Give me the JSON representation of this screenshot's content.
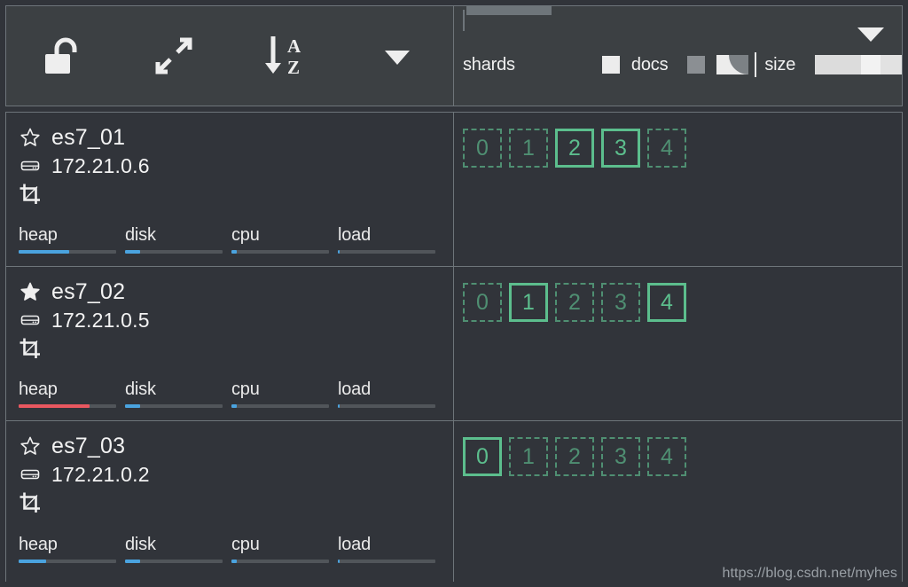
{
  "toolbar": {
    "buttons": [
      {
        "name": "unlock-icon",
        "label": "unlock"
      },
      {
        "name": "expand-arrows-icon",
        "label": "expand"
      },
      {
        "name": "sort-az-icon",
        "label": "sort A-Z"
      },
      {
        "name": "chevron-down-icon",
        "label": "more"
      }
    ]
  },
  "legend": {
    "shards_label": "shards",
    "docs_label": "docs",
    "size_label": "size",
    "caret": "▼"
  },
  "colors": {
    "background": "#31343a",
    "panel": "#3c4043",
    "border": "#6e757a",
    "primary_shard": "#5cbe8d",
    "replica_shard": "#4f8f72",
    "bar_normal": "#4aa3df",
    "bar_warn": "#e8575f",
    "bar_track": "#51555a",
    "text": "#f3f3f3"
  },
  "metric_labels": [
    "heap",
    "disk",
    "cpu",
    "load"
  ],
  "nodes": [
    {
      "name": "es7_01",
      "ip": "172.21.0.6",
      "master": false,
      "star_icon": "star-outline-icon",
      "host_icon": "server-icon",
      "crop_icon": "crop-icon",
      "metrics": [
        {
          "label": "heap",
          "percent": 52,
          "color": "#4aa3df"
        },
        {
          "label": "disk",
          "percent": 15,
          "color": "#4aa3df"
        },
        {
          "label": "cpu",
          "percent": 5,
          "color": "#4aa3df"
        },
        {
          "label": "load",
          "percent": 2,
          "color": "#4aa3df"
        }
      ],
      "shards": [
        {
          "id": "0",
          "type": "replica"
        },
        {
          "id": "1",
          "type": "replica"
        },
        {
          "id": "2",
          "type": "primary"
        },
        {
          "id": "3",
          "type": "primary"
        },
        {
          "id": "4",
          "type": "replica"
        }
      ]
    },
    {
      "name": "es7_02",
      "ip": "172.21.0.5",
      "master": true,
      "star_icon": "star-filled-icon",
      "host_icon": "server-icon",
      "crop_icon": "crop-icon",
      "metrics": [
        {
          "label": "heap",
          "percent": 73,
          "color": "#e8575f"
        },
        {
          "label": "disk",
          "percent": 15,
          "color": "#4aa3df"
        },
        {
          "label": "cpu",
          "percent": 5,
          "color": "#4aa3df"
        },
        {
          "label": "load",
          "percent": 2,
          "color": "#4aa3df"
        }
      ],
      "shards": [
        {
          "id": "0",
          "type": "replica"
        },
        {
          "id": "1",
          "type": "primary"
        },
        {
          "id": "2",
          "type": "replica"
        },
        {
          "id": "3",
          "type": "replica"
        },
        {
          "id": "4",
          "type": "primary"
        }
      ]
    },
    {
      "name": "es7_03",
      "ip": "172.21.0.2",
      "master": false,
      "star_icon": "star-outline-icon",
      "host_icon": "server-icon",
      "crop_icon": "crop-icon",
      "metrics": [
        {
          "label": "heap",
          "percent": 28,
          "color": "#4aa3df"
        },
        {
          "label": "disk",
          "percent": 15,
          "color": "#4aa3df"
        },
        {
          "label": "cpu",
          "percent": 5,
          "color": "#4aa3df"
        },
        {
          "label": "load",
          "percent": 2,
          "color": "#4aa3df"
        }
      ],
      "shards": [
        {
          "id": "0",
          "type": "primary"
        },
        {
          "id": "1",
          "type": "replica"
        },
        {
          "id": "2",
          "type": "replica"
        },
        {
          "id": "3",
          "type": "replica"
        },
        {
          "id": "4",
          "type": "replica"
        }
      ]
    }
  ],
  "watermark": "https://blog.csdn.net/myhes"
}
